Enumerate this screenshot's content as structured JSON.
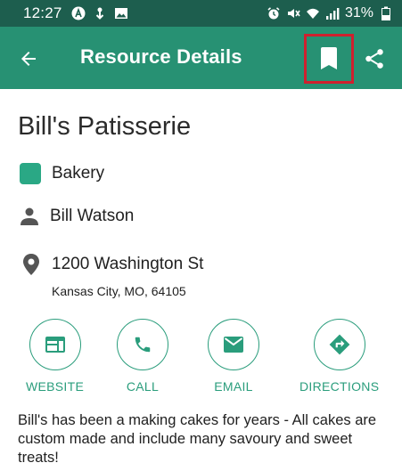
{
  "status_bar": {
    "time": "12:27",
    "battery": "31%",
    "icons_left": [
      "a-circle-icon",
      "download-icon",
      "image-icon"
    ],
    "icons_right": [
      "alarm-icon",
      "mute-icon",
      "wifi-icon",
      "signal-icon",
      "battery-icon"
    ]
  },
  "app_bar": {
    "title": "Resource Details",
    "back_icon": "arrow-left-icon",
    "bookmark_icon": "bookmark-icon",
    "share_icon": "share-icon"
  },
  "resource": {
    "name": "Bill's Patisserie",
    "category": "Bakery",
    "contact": "Bill Watson",
    "address_line1": "1200 Washington St",
    "address_line2": "Kansas City, MO, 64105",
    "description": "Bill's has been a making cakes for years - All cakes are custom made and include many savoury and sweet treats!"
  },
  "actions": {
    "website": "WEBSITE",
    "call": "CALL",
    "email": "EMAIL",
    "directions": "DIRECTIONS"
  },
  "colors": {
    "status_bar": "#1d5e4e",
    "app_bar": "#279173",
    "accent": "#2a9d7c",
    "category": "#2aa885",
    "highlight": "#d0202e"
  }
}
